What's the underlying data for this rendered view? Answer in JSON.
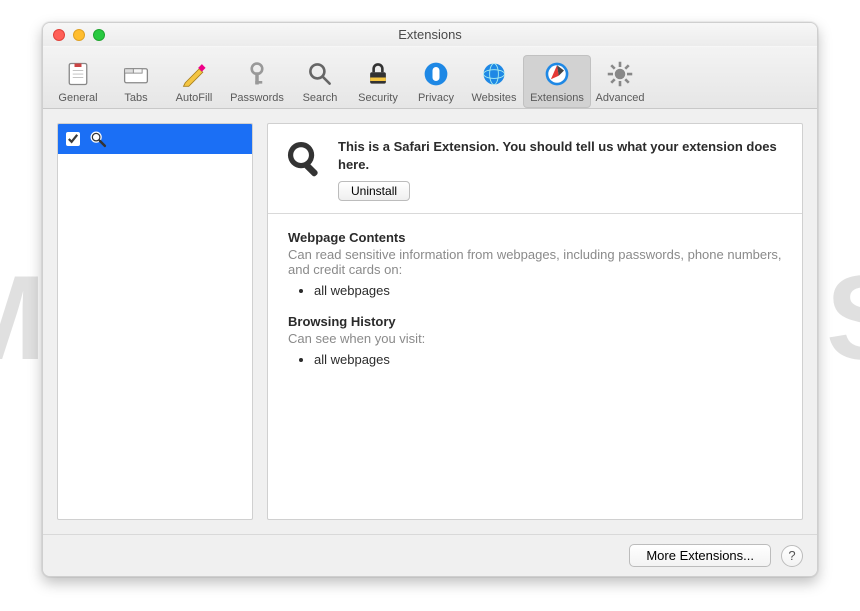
{
  "window": {
    "title": "Extensions"
  },
  "toolbar": {
    "items": [
      {
        "label": "General"
      },
      {
        "label": "Tabs"
      },
      {
        "label": "AutoFill"
      },
      {
        "label": "Passwords"
      },
      {
        "label": "Search"
      },
      {
        "label": "Security"
      },
      {
        "label": "Privacy"
      },
      {
        "label": "Websites"
      },
      {
        "label": "Extensions"
      },
      {
        "label": "Advanced"
      }
    ]
  },
  "sidebar": {
    "items": [
      {
        "checked": true,
        "icon": "search-icon"
      }
    ]
  },
  "detail": {
    "description": "This is a Safari Extension. You should tell us what your extension does here.",
    "uninstall_label": "Uninstall",
    "sections": [
      {
        "title": "Webpage Contents",
        "subtitle": "Can read sensitive information from webpages, including passwords, phone numbers, and credit cards on:",
        "items": [
          "all webpages"
        ]
      },
      {
        "title": "Browsing History",
        "subtitle": "Can see when you visit:",
        "items": [
          "all webpages"
        ]
      }
    ]
  },
  "footer": {
    "more_label": "More Extensions...",
    "help_label": "?"
  },
  "watermark": "MALWARETIPS"
}
